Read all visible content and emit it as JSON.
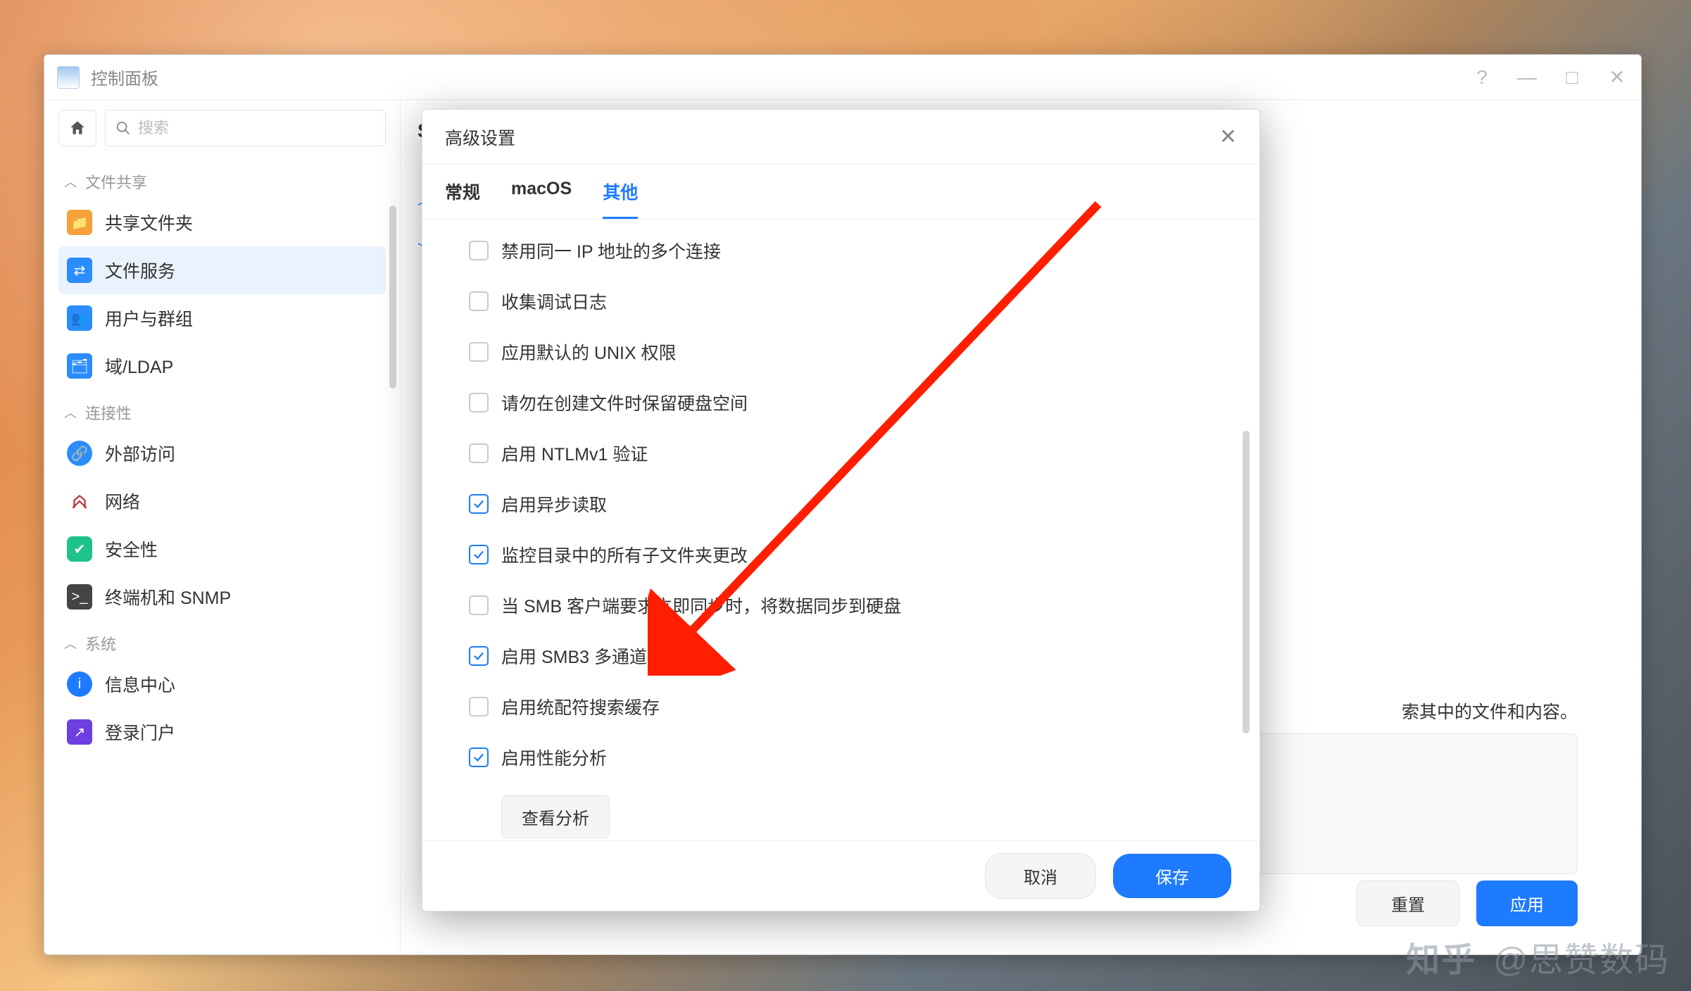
{
  "window": {
    "title": "控制面板"
  },
  "search": {
    "placeholder": "搜索"
  },
  "sidebar": {
    "groups": [
      {
        "label": "文件共享"
      },
      {
        "label": "连接性"
      },
      {
        "label": "系统"
      }
    ],
    "items": [
      {
        "label": "共享文件夹"
      },
      {
        "label": "文件服务"
      },
      {
        "label": "用户与群组"
      },
      {
        "label": "域/LDAP"
      },
      {
        "label": "外部访问"
      },
      {
        "label": "网络"
      },
      {
        "label": "安全性"
      },
      {
        "label": "终端机和 SNMP"
      },
      {
        "label": "信息中心"
      },
      {
        "label": "登录门户"
      }
    ]
  },
  "main": {
    "partial_tab_letter": "S",
    "hint_text_suffix": "索其中的文件和内容。",
    "reset": "重置",
    "apply": "应用"
  },
  "modal": {
    "title": "高级设置",
    "tabs": [
      {
        "label": "常规"
      },
      {
        "label": "macOS"
      },
      {
        "label": "其他"
      }
    ],
    "options": [
      {
        "label": "禁用同一 IP 地址的多个连接",
        "checked": false
      },
      {
        "label": "收集调试日志",
        "checked": false
      },
      {
        "label": "应用默认的 UNIX 权限",
        "checked": false
      },
      {
        "label": "请勿在创建文件时保留硬盘空间",
        "checked": false
      },
      {
        "label": "启用 NTLMv1 验证",
        "checked": false
      },
      {
        "label": "启用异步读取",
        "checked": true
      },
      {
        "label": "监控目录中的所有子文件夹更改",
        "checked": true
      },
      {
        "label": "当 SMB 客户端要求立即同步时，将数据同步到硬盘",
        "checked": false
      },
      {
        "label": "启用 SMB3 多通道",
        "checked": true
      },
      {
        "label": "启用统配符搜索缓存",
        "checked": false
      },
      {
        "label": "启用性能分析",
        "checked": true
      }
    ],
    "view_analysis": "查看分析",
    "cancel": "取消",
    "save": "保存"
  },
  "watermark": {
    "logo": "知乎",
    "author": "@思赞数码"
  }
}
